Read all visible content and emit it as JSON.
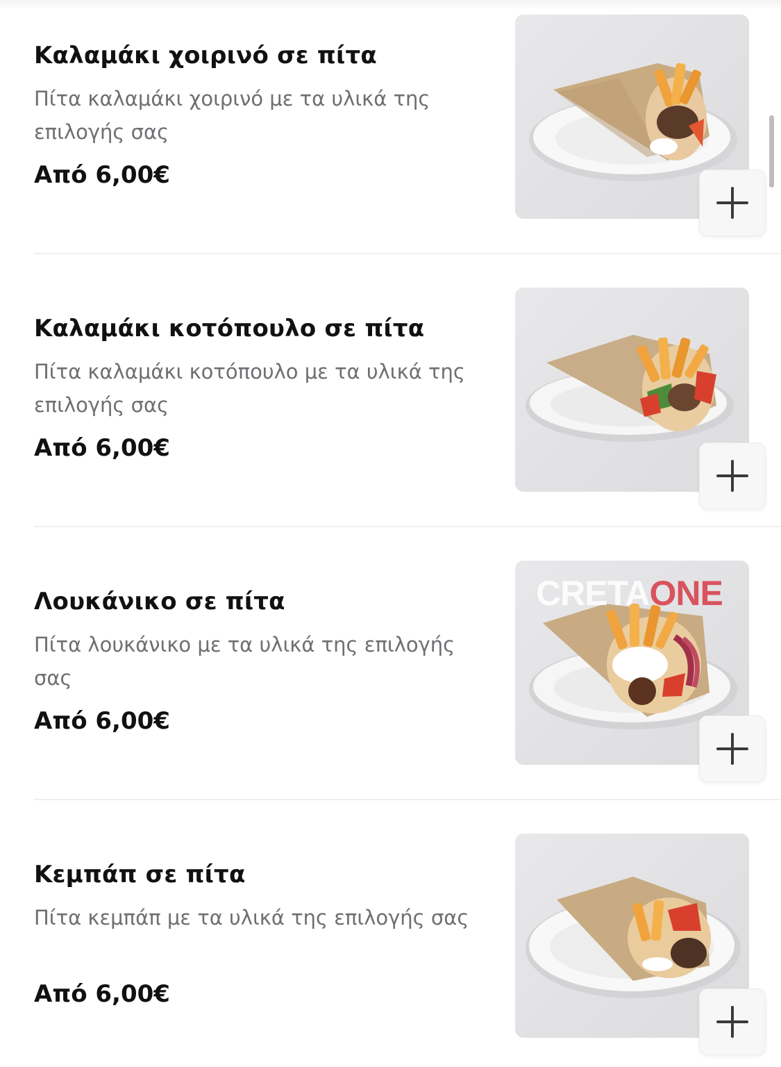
{
  "menu": {
    "add_icon": "plus-icon",
    "items": [
      {
        "title": "Καλαμάκι χοιρινό σε πίτα",
        "description": "Πίτα καλαμάκι χοιρινό με τα υλικά της επιλογής σας",
        "price": "Από 6,00€"
      },
      {
        "title": "Καλαμάκι κοτόπουλο σε πίτα",
        "description": "Πίτα καλαμάκι κοτόπουλο με τα υλικά της επιλογής σας",
        "price": "Από 6,00€"
      },
      {
        "title": "Λουκάνικο σε πίτα",
        "description": "Πίτα λουκάνικο με τα υλικά της επιλογής σας",
        "price": "Από 6,00€"
      },
      {
        "title": "Κεμπάπ σε πίτα",
        "description": "Πίτα κεμπάπ με τα υλικά της επιλογής σας",
        "price": "Από 6,00€"
      }
    ],
    "watermark": {
      "part1": "CRETA",
      "part2": "ONE",
      "accent_color": "#d9535f"
    }
  }
}
